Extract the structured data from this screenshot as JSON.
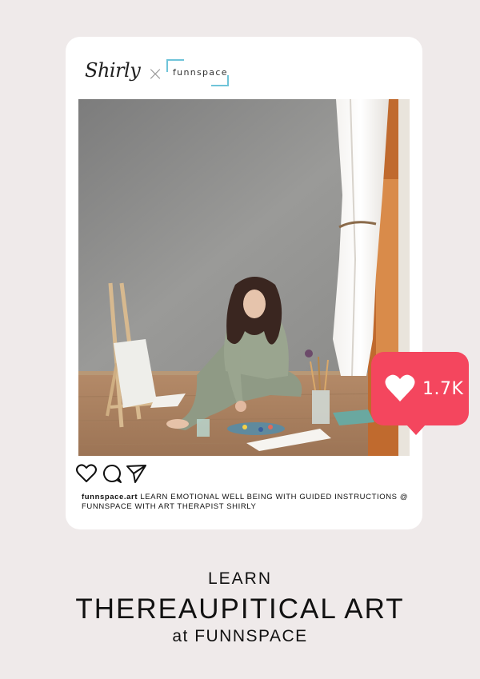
{
  "post": {
    "brand": {
      "signature": "Shirly",
      "separator": "×",
      "partner": "funnspace"
    },
    "photo_alt": "",
    "actions": {
      "like_icon": "heart-outline-icon",
      "comment_icon": "comment-bubble-icon",
      "share_icon": "paper-plane-icon"
    },
    "caption": {
      "handle": "funnspace.art",
      "text": "LEARN EMOTIONAL WELL BEING WITH GUIDED INSTRUCTIONS @ FUNNSPACE WITH ART THERAPIST SHIRLY"
    }
  },
  "likes": {
    "count": "1.7K",
    "icon": "heart-filled-icon",
    "color": "#f4465e"
  },
  "headline": {
    "line1": "LEARN",
    "line2": "THEREAUPITICAL ART",
    "line3": "at FUNNSPACE"
  },
  "colors": {
    "page_background": "#efeaea",
    "card_background": "#ffffff",
    "partner_accent": "#6fc4d9"
  }
}
